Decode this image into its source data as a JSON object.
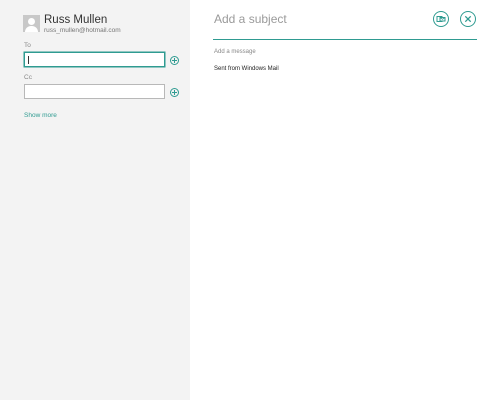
{
  "account": {
    "name": "Russ Mullen",
    "email": "russ_mullen@hotmail.com"
  },
  "recipients": {
    "to_label": "To",
    "to_value": "",
    "cc_label": "Cc",
    "cc_value": "",
    "show_more_label": "Show more"
  },
  "message": {
    "subject_placeholder": "Add a subject",
    "body_placeholder": "Add a message",
    "signature": "Sent from Windows Mail"
  },
  "icons": {
    "avatar": "person-icon",
    "add": "add-contact-icon",
    "send": "send-icon",
    "close": "close-icon"
  },
  "colors": {
    "accent": "#2f9b91",
    "left_pane_bg": "#f3f3f3"
  }
}
